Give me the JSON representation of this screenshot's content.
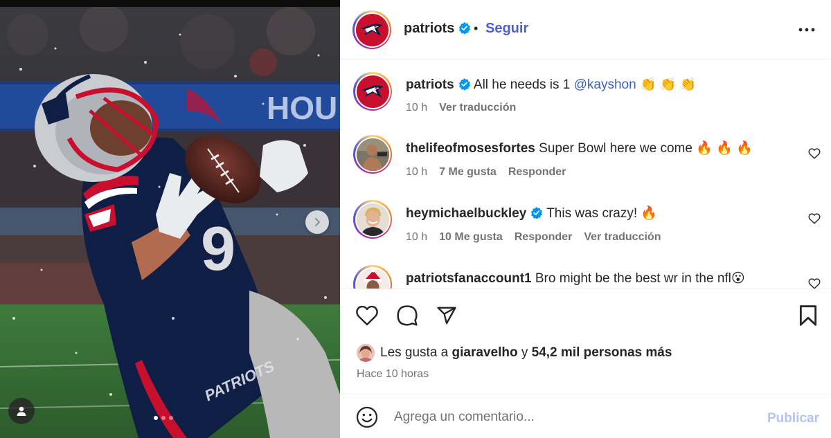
{
  "post": {
    "author": "patriots",
    "verified": true,
    "follow_label": "Seguir",
    "separator": "•",
    "more_icon": "more-horizontal-icon",
    "colors": {
      "accent": "#4a5ddc",
      "mention": "#3c5fbf",
      "muted": "#737373",
      "text": "#262626",
      "publish_disabled": "#b5c2f5",
      "patriots_red": "#c8102e",
      "patriots_navy": "#002244"
    }
  },
  "caption": {
    "username": "patriots",
    "text_before": " All he needs is 1 ",
    "mention": "@kayshon",
    "emojis": " 👏 👏 👏",
    "time": "10 h",
    "translate": "Ver traducción"
  },
  "comments": [
    {
      "username": "thelifeofmosesfortes",
      "verified": false,
      "text": " Super Bowl here we come 🔥 🔥 🔥",
      "time": "10 h",
      "likes": "7 Me gusta",
      "reply": "Responder",
      "translate": ""
    },
    {
      "username": "heymichaelbuckley",
      "verified": true,
      "text": " This was crazy! 🔥",
      "time": "10 h",
      "likes": "10 Me gusta",
      "reply": "Responder",
      "translate": "Ver traducción"
    },
    {
      "username": "patriotsfanaccount1",
      "verified": false,
      "text": " Bro might be the best wr in the nfl😮",
      "time": "",
      "likes": "",
      "reply": "",
      "translate": ""
    }
  ],
  "likes": {
    "prefix": "Les gusta a ",
    "liker": "giaravelho",
    "middle": " y ",
    "others": "54,2 mil personas más"
  },
  "posted_ago": "Hace 10 horas",
  "comment_box": {
    "placeholder": "Agrega un comentario...",
    "publish_label": "Publicar"
  },
  "carousel": {
    "total_slides": 3,
    "current_slide": 1
  }
}
